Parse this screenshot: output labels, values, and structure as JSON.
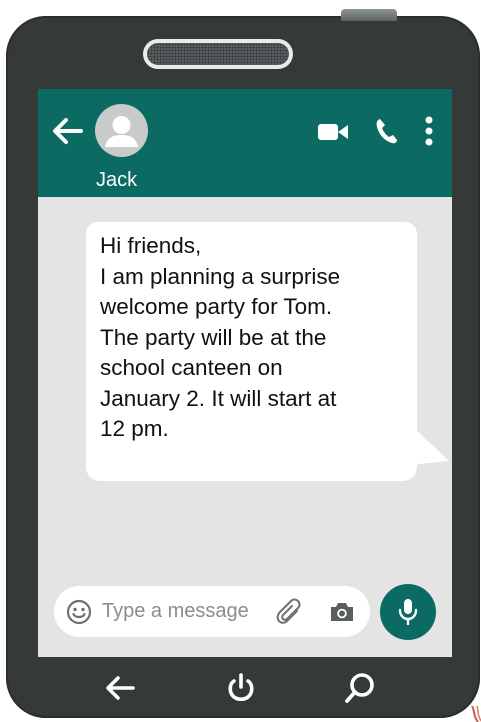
{
  "colors": {
    "phone_body": "#353a39",
    "header_teal": "#0b6b62",
    "screen_background": "#e3e4e3",
    "bubble": "#ffffff",
    "mic_button": "#0b6b62"
  },
  "header": {
    "contact_name": "Jack",
    "icons": [
      "back-arrow-icon",
      "avatar-icon",
      "video-camera-icon",
      "phone-icon",
      "more-vertical-icon"
    ]
  },
  "chat": {
    "message": "Hi friends,\nI am planning a surprise\nwelcome party for Tom.\nThe party will be at the\nschool canteen on\nJanuary 2. It will start at\n12 pm."
  },
  "composer": {
    "placeholder": "Type a message",
    "icons": [
      "emoji-icon",
      "paperclip-icon",
      "camera-icon",
      "microphone-icon"
    ]
  },
  "nav_bar": {
    "icons": [
      "back-arrow-icon",
      "power-icon",
      "search-icon"
    ]
  }
}
